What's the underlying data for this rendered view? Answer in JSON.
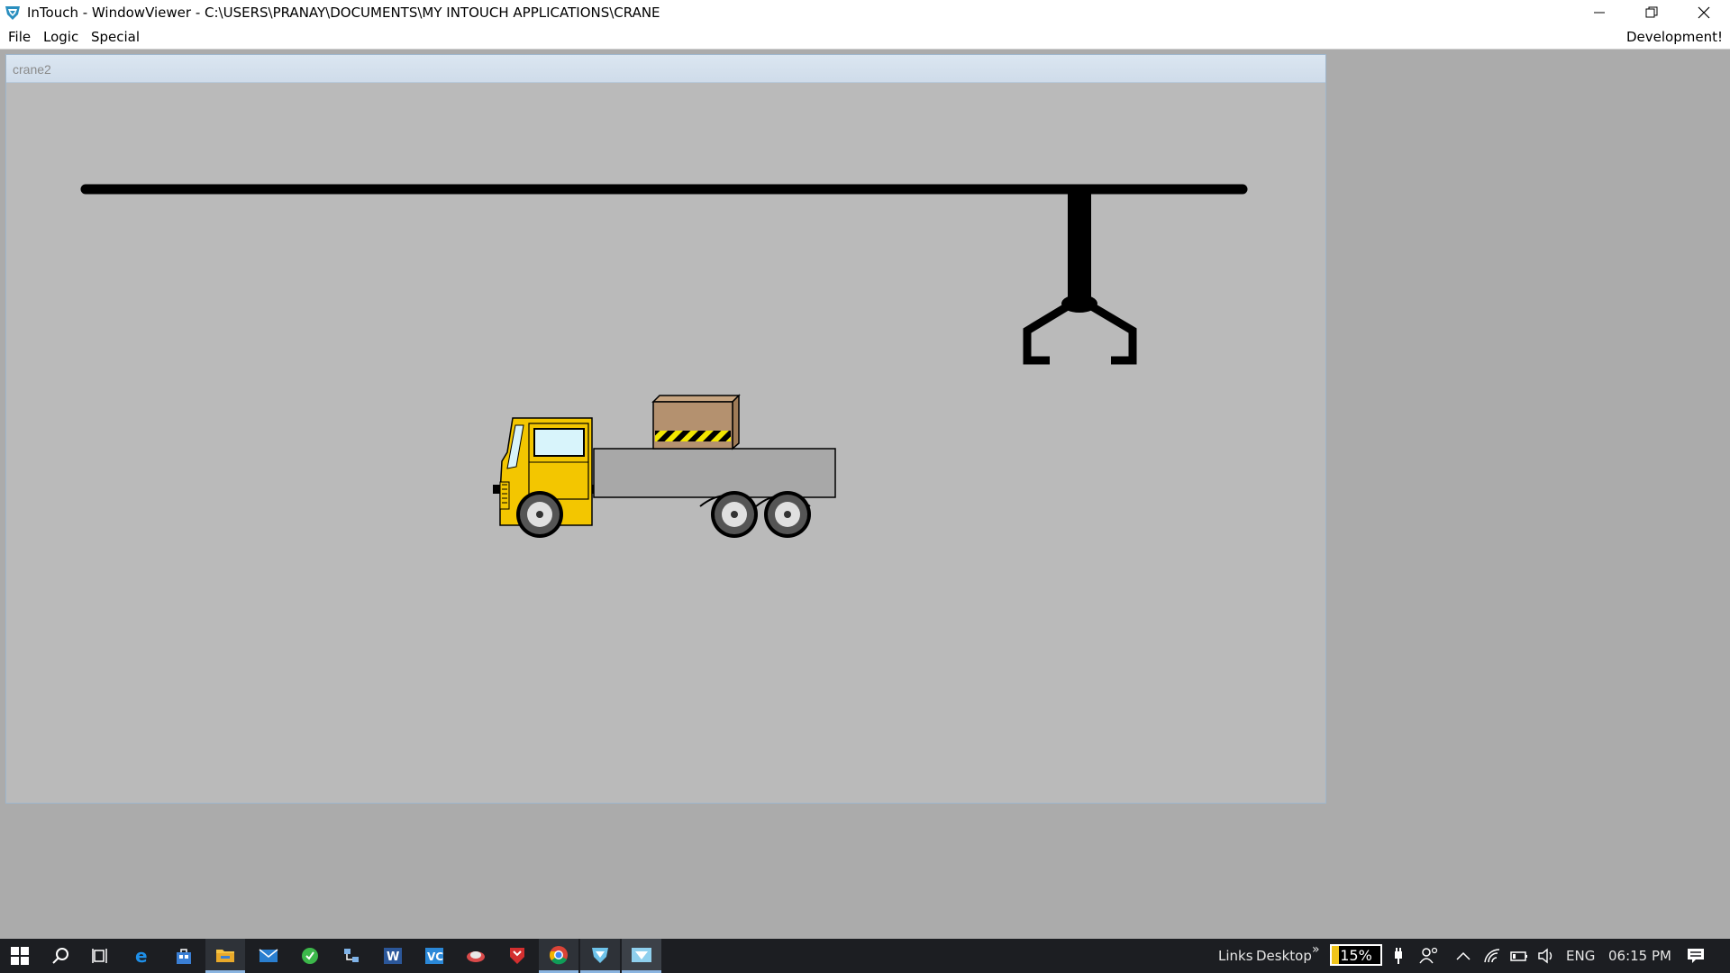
{
  "window": {
    "title": "InTouch - WindowViewer - C:\\USERS\\PRANAY\\DOCUMENTS\\MY INTOUCH APPLICATIONS\\CRANE",
    "controls": [
      "minimize",
      "restore",
      "close"
    ]
  },
  "menu": {
    "items": [
      "File",
      "Logic",
      "Special"
    ],
    "right_label": "Development!"
  },
  "inner_window": {
    "title": "crane2"
  },
  "taskbar": {
    "icons": [
      "windows-start-icon",
      "search-icon",
      "task-view-icon",
      "edge-icon",
      "store-icon",
      "file-explorer-icon",
      "mail-icon",
      "green-app-icon",
      "network-app-icon",
      "word-icon",
      "vc-app-icon",
      "cloud-app-icon",
      "shield-app-icon",
      "chrome-icon",
      "intouch-manager-icon",
      "intouch-viewer-icon"
    ],
    "links_label": "Links",
    "desktop_label": "Desktop",
    "chevron": "»",
    "battery_percent_label": "15%",
    "battery_level": 0.15,
    "language": "ENG",
    "time": "06:15 PM"
  },
  "colors": {
    "truck_yellow": "#f3c600",
    "crate_brown": "#b4916f",
    "flatbed_gray": "#a8a8a8",
    "crane_black": "#000000",
    "background": "#bababa"
  }
}
